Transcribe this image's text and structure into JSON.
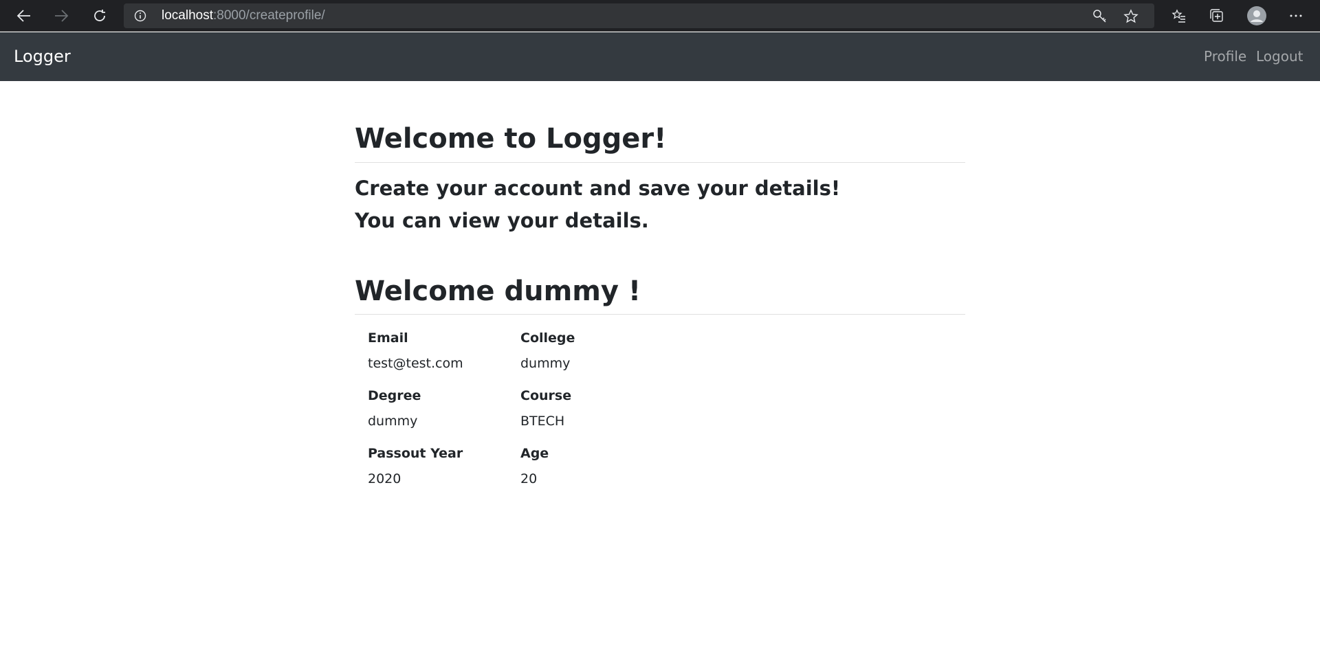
{
  "browser": {
    "url_host": "localhost",
    "url_path": ":8000/createprofile/"
  },
  "navbar": {
    "brand": "Logger",
    "links": [
      "Profile",
      "Logout"
    ]
  },
  "main": {
    "title": "Welcome to Logger!",
    "lead_line1": "Create your account and save your details!",
    "lead_line2": "You can view your details.",
    "welcome": "Welcome dummy !",
    "fields": [
      {
        "label": "Email",
        "value": "test@test.com"
      },
      {
        "label": "College",
        "value": "dummy"
      },
      {
        "label": "Degree",
        "value": "dummy"
      },
      {
        "label": "Course",
        "value": "BTECH"
      },
      {
        "label": "Passout Year",
        "value": "2020"
      },
      {
        "label": "Age",
        "value": "20"
      }
    ]
  }
}
